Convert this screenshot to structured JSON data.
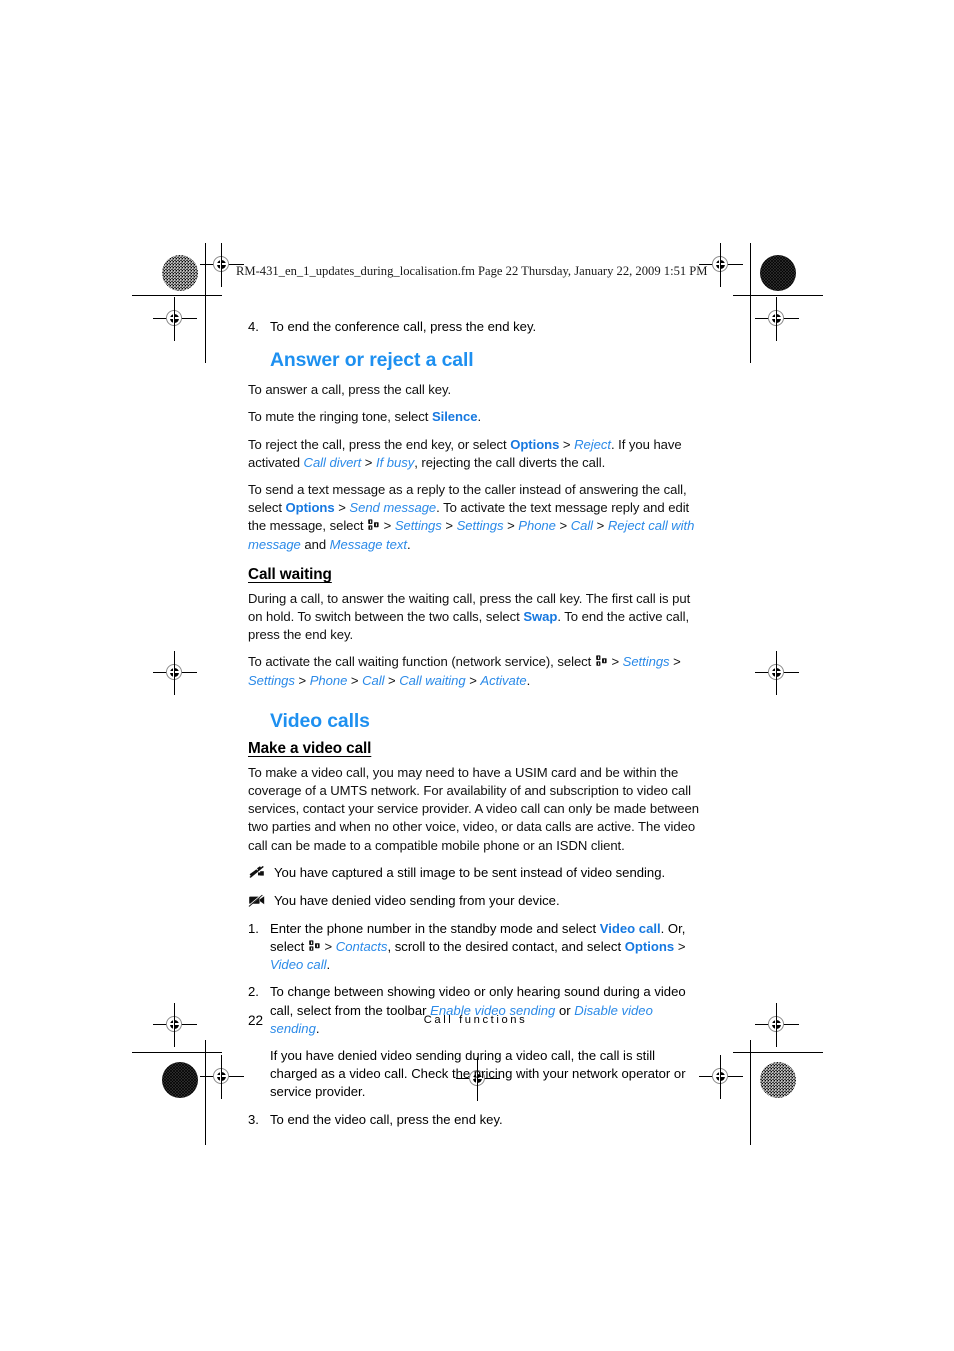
{
  "file_header": "RM-431_en_1_updates_during_localisation.fm  Page 22  Thursday, January 22, 2009  1:51 PM",
  "colors": {
    "heading_blue": "#1e90f0",
    "ui_label_blue": "#1678e0",
    "path_blue": "#2b8ae8",
    "body_black": "#101010"
  },
  "icons": {
    "menu_key": "menu-key-icon",
    "still_image_sent": "camera-still-image-crossed-icon",
    "video_denied": "video-camera-denied-icon"
  },
  "step4": {
    "num": "4.",
    "text": "To end the conference call, press the end key."
  },
  "section_answer": {
    "heading": "Answer or reject a call",
    "p1": "To answer a call, press the call key.",
    "p2": {
      "a": "To mute the ringing tone, select ",
      "silence": "Silence",
      "b": "."
    },
    "p3": {
      "a": "To reject the call, press the end key, or select ",
      "options": "Options",
      "sep1": " > ",
      "reject": "Reject",
      "b": ". If you have activated ",
      "call_divert": "Call divert",
      "sep2": " > ",
      "if_busy": "If busy",
      "c": ", rejecting the call diverts the call."
    },
    "p4": {
      "a": "To send a text message as a reply to the caller instead of answering the call, select ",
      "options": "Options",
      "sep1": " > ",
      "send_message": "Send message",
      "b": ". To activate the text message reply and edit the message, select ",
      "sep2": " > ",
      "settings1": "Settings",
      "sep3": " > ",
      "settings2": "Settings",
      "sep4": " > ",
      "phone": "Phone",
      "sep5": " > ",
      "call": "Call",
      "sep6": " > ",
      "reject_with_msg": "Reject call with message",
      "c": " and ",
      "message_text": "Message text",
      "d": "."
    }
  },
  "section_call_waiting": {
    "heading": "Call waiting",
    "p1": {
      "a": "During a call, to answer the waiting call, press the call key. The first call is put on hold. To switch between the two calls, select ",
      "swap": "Swap",
      "b": ". To end the active call, press the end key."
    },
    "p2": {
      "a": "To activate the call waiting function (network service), select ",
      "sep1": " > ",
      "settings1": "Settings",
      "sep2": " > ",
      "settings2": "Settings",
      "sep3": " > ",
      "phone": "Phone",
      "sep4": " > ",
      "call": "Call",
      "sep5": " > ",
      "call_waiting": "Call waiting",
      "sep6": " > ",
      "activate": "Activate",
      "b": "."
    }
  },
  "section_video_calls": {
    "heading": "Video calls",
    "subheading": "Make a video call",
    "p1": "To make a video call, you may need to have a USIM card and be within the coverage of a UMTS network. For availability of and subscription to video call services, contact your service provider. A video call can only be made between two parties and when no other voice, video, or data calls are active. The video call can be made to a compatible mobile phone or an ISDN client.",
    "icon_notes": [
      "You have captured a still image to be sent instead of video sending.",
      "You have denied video sending from your device."
    ],
    "steps": [
      {
        "num": "1.",
        "a": "Enter the phone number in the standby mode and select ",
        "video_call_bold": "Video call",
        "b": ". Or, select ",
        "sep1": " > ",
        "contacts": "Contacts",
        "c": ", scroll to the desired contact, and select ",
        "options": "Options",
        "sep2": " > ",
        "video_call_italic": "Video call",
        "d": "."
      },
      {
        "num": "2.",
        "a": "To change between showing video or only hearing sound during a video call, select from the toolbar ",
        "enable": "Enable video sending",
        "b": " or ",
        "disable": "Disable video sending",
        "c": ".",
        "continuation": "If you have denied video sending during a video call, the call is still charged as a video call. Check the pricing with your network operator or service provider."
      },
      {
        "num": "3.",
        "a": "To end the video call, press the end key."
      }
    ]
  },
  "footer": {
    "page_number": "22",
    "section_label": "Call functions"
  }
}
